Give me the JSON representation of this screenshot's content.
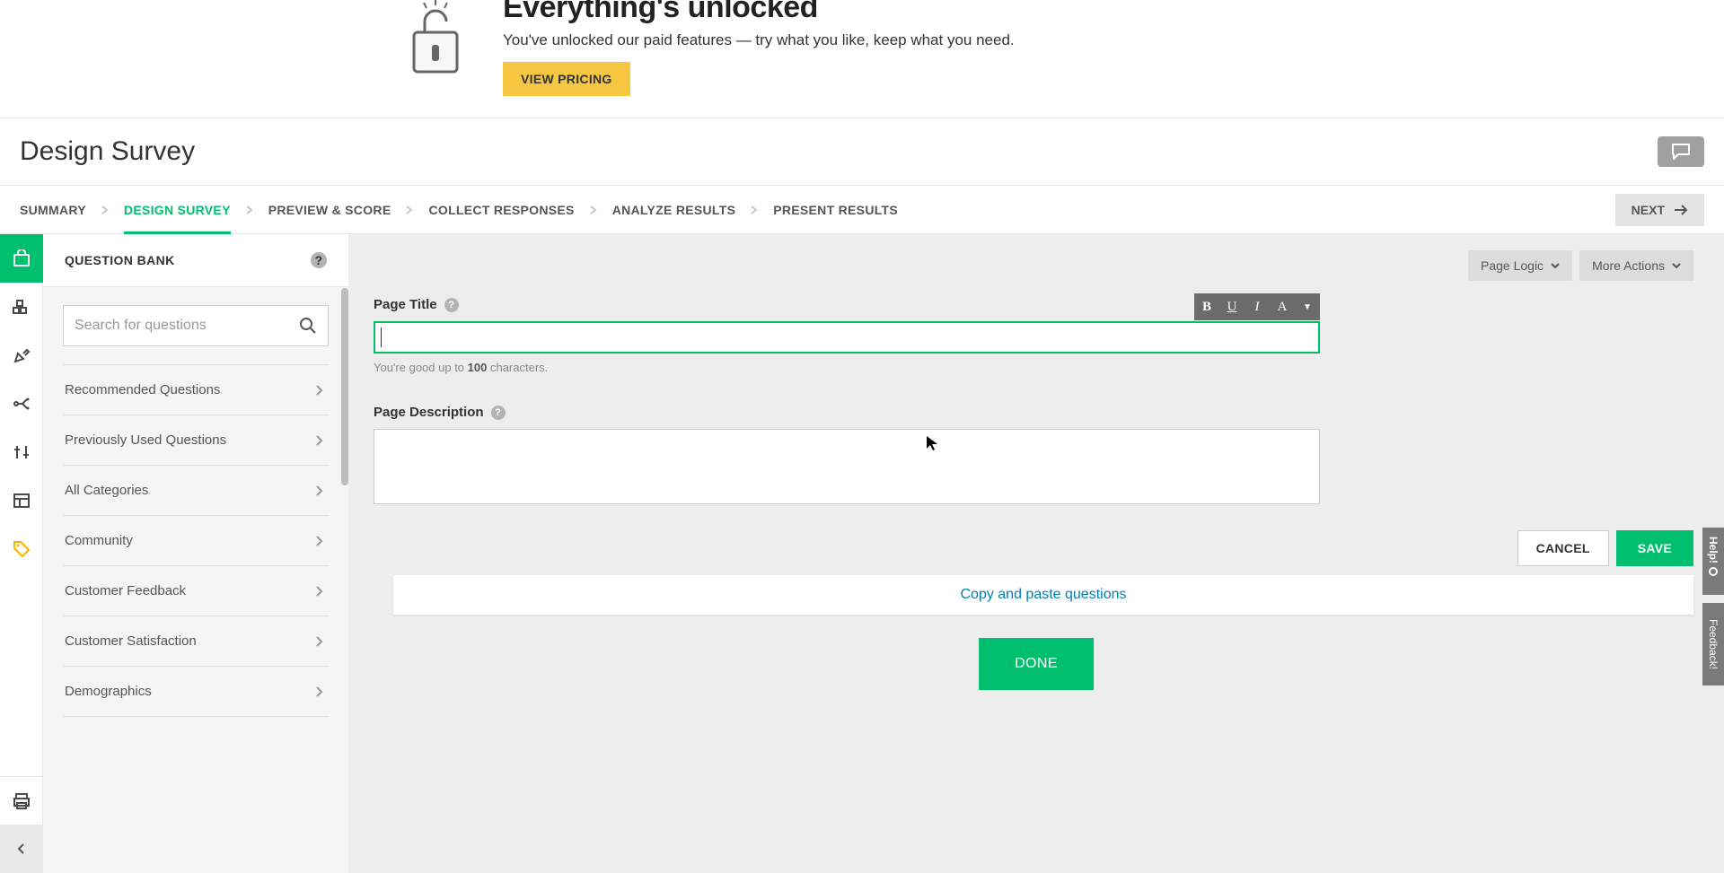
{
  "promo": {
    "title": "Everything's unlocked",
    "subtitle": "You've unlocked our paid features — try what you like, keep what you need.",
    "button": "VIEW PRICING"
  },
  "page_title": "Design Survey",
  "tabs": {
    "items": [
      "SUMMARY",
      "DESIGN SURVEY",
      "PREVIEW & SCORE",
      "COLLECT RESPONSES",
      "ANALYZE RESULTS",
      "PRESENT RESULTS"
    ],
    "active_index": 1,
    "next_label": "NEXT"
  },
  "sidebar": {
    "header": "QUESTION BANK",
    "search_placeholder": "Search for questions",
    "categories": [
      "Recommended Questions",
      "Previously Used Questions",
      "All Categories",
      "Community",
      "Customer Feedback",
      "Customer Satisfaction",
      "Demographics"
    ]
  },
  "page_actions": {
    "logic": "Page Logic",
    "more": "More Actions"
  },
  "editor": {
    "title_label": "Page Title",
    "title_value": "",
    "hint_prefix": "You're good up to ",
    "hint_bold": "100",
    "hint_suffix": " characters.",
    "desc_label": "Page Description",
    "desc_value": "",
    "cancel": "CANCEL",
    "save": "SAVE"
  },
  "canvas": {
    "copy_paste": "Copy and paste questions",
    "done": "DONE"
  },
  "side": {
    "help": "Help!",
    "feedback": "Feedback!"
  }
}
